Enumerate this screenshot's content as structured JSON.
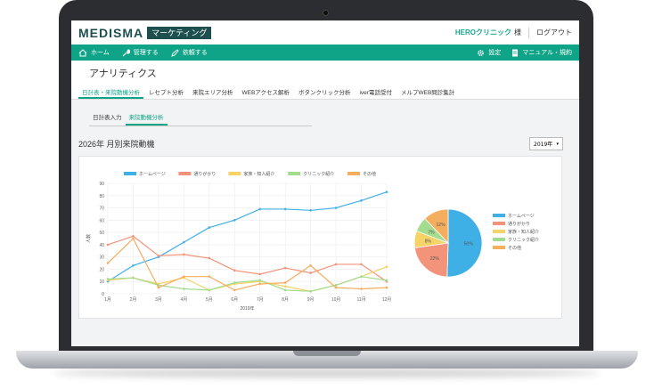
{
  "header": {
    "logo": "MEDISMA",
    "logo_tag": "マーケティング",
    "clinic_name": "HEROクリニック",
    "clinic_suffix": "様",
    "logout": "ログアウト"
  },
  "nav": {
    "home": "ホーム",
    "manage": "管理する",
    "post": "依頼する",
    "settings": "設定",
    "manual": "マニュアル・規約"
  },
  "page": {
    "title": "アナリティクス",
    "tabs": [
      "日計表・来院動機分析",
      "レセプト分析",
      "来院エリア分析",
      "WEBアクセス解析",
      "ボタンクリック分析",
      "iver電話受付",
      "メルプWEB問診集計"
    ],
    "subtabs": [
      "日計表入力",
      "来院動機分析"
    ],
    "section_title": "2026年 月別来院動機",
    "year_select": "2019年",
    "year_arrow": "▾"
  },
  "colors": {
    "accent": "#0fa487",
    "home_page": "#3fb0e6",
    "passing": "#f2937a",
    "family": "#f5d366",
    "clinic": "#a3dc8e",
    "other": "#f5ad5e"
  },
  "chart_data": [
    {
      "type": "line",
      "x": [
        "1月",
        "2月",
        "3月",
        "4月",
        "5月",
        "6月",
        "7月",
        "8月",
        "9月",
        "10月",
        "11月",
        "12月"
      ],
      "xlabel": "2019年",
      "ylabel": "人数",
      "ylim": [
        0,
        90
      ],
      "yticks": [
        0,
        10,
        20,
        30,
        40,
        50,
        60,
        70,
        80,
        90
      ],
      "grid": true,
      "legend_position": "top",
      "series": [
        {
          "name": "ホームページ",
          "values": [
            10,
            23,
            30,
            42,
            54,
            60,
            69,
            69,
            68,
            70,
            76,
            83
          ]
        },
        {
          "name": "通りがかり",
          "values": [
            40,
            47,
            31,
            32,
            29,
            19,
            16,
            21,
            17,
            24,
            24,
            10
          ]
        },
        {
          "name": "家族・知人紹介",
          "values": [
            11,
            13,
            8,
            13,
            3,
            8,
            10,
            6,
            2,
            7,
            14,
            22
          ]
        },
        {
          "name": "クリニック紹介",
          "values": [
            12,
            13,
            7,
            4,
            3,
            9,
            11,
            3,
            2,
            7,
            14,
            11
          ]
        },
        {
          "name": "その他",
          "values": [
            25,
            45,
            5,
            14,
            14,
            3,
            8,
            9,
            23,
            5,
            4,
            5
          ]
        }
      ]
    },
    {
      "type": "pie",
      "labels": [
        "ホームページ",
        "通りがかり",
        "家族・知人紹介",
        "クリニック紹介",
        "その他"
      ],
      "values": [
        50,
        22,
        8,
        7,
        12
      ],
      "value_labels": [
        "50%",
        "22%",
        "8%",
        "7%",
        "12%"
      ],
      "legend_position": "right"
    }
  ]
}
